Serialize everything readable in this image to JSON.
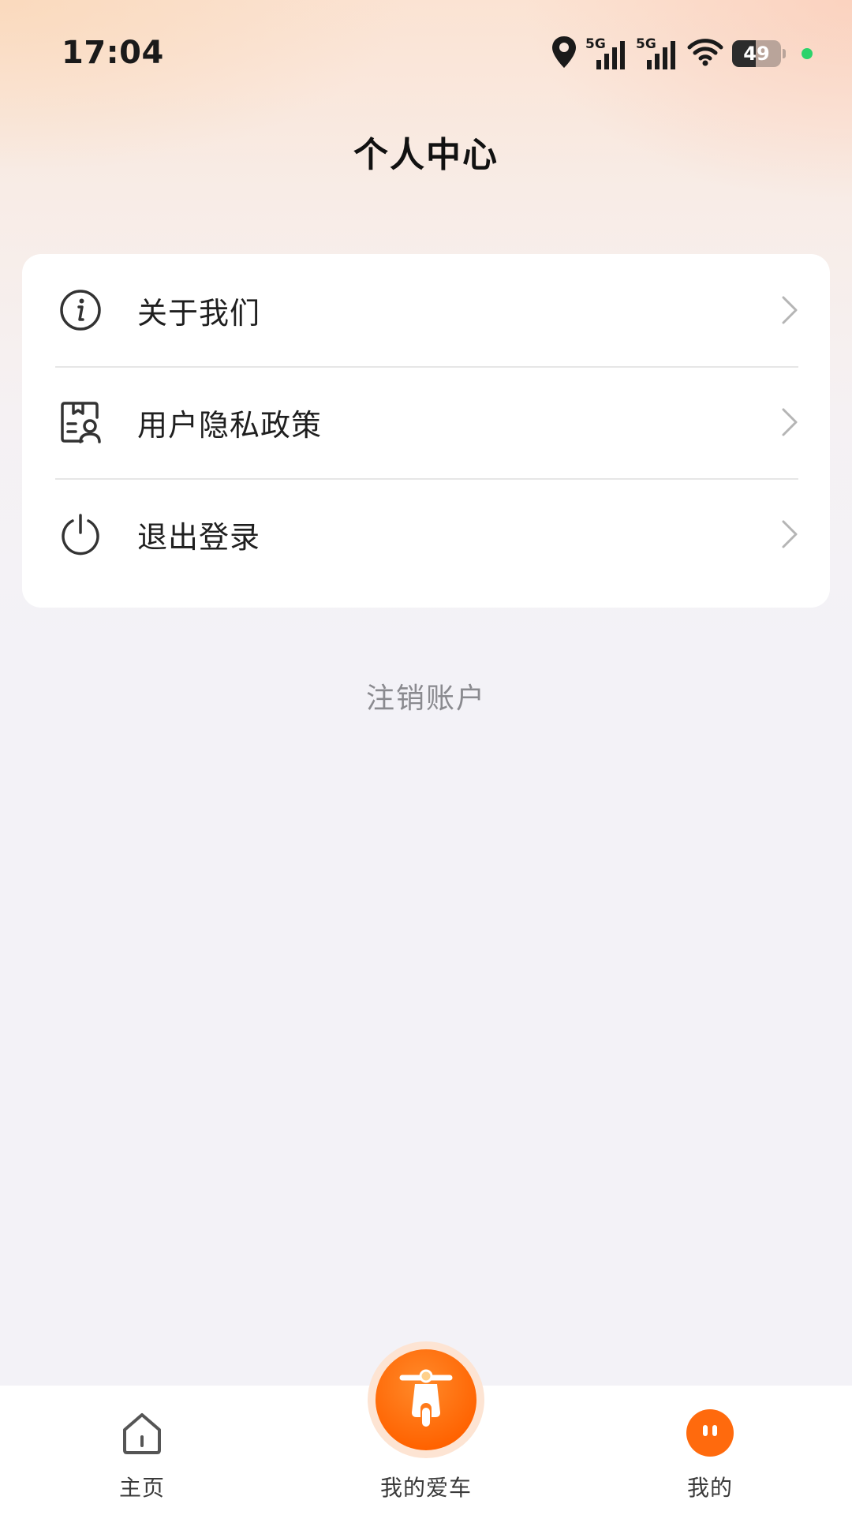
{
  "status_bar": {
    "time": "17:04",
    "signal_1_label": "5G",
    "signal_2_label": "5G",
    "battery_level": "49"
  },
  "header": {
    "title": "个人中心"
  },
  "menu": {
    "items": [
      {
        "label": "关于我们",
        "icon": "info-icon"
      },
      {
        "label": "用户隐私政策",
        "icon": "privacy-document-icon"
      },
      {
        "label": "退出登录",
        "icon": "power-icon"
      }
    ]
  },
  "cancel_account_label": "注销账户",
  "bottom_nav": {
    "items": [
      {
        "label": "主页",
        "icon": "home-icon"
      },
      {
        "label": "我的爱车",
        "icon": "scooter-icon"
      },
      {
        "label": "我的",
        "icon": "profile-face-icon"
      }
    ],
    "active_color": "#ff6a0d"
  }
}
